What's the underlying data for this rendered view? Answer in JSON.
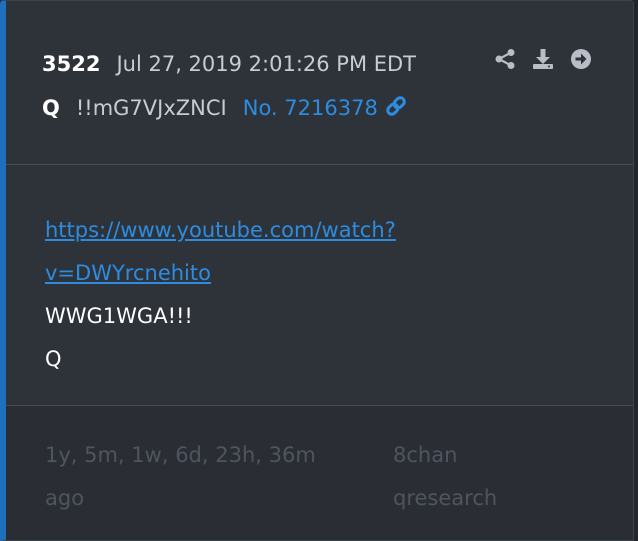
{
  "post": {
    "number": "3522",
    "date": "Jul 27, 2019 2:01:26 PM EDT",
    "author": "Q",
    "tripcode": "!!mG7VJxZNCI",
    "post_no": "No. 7216378",
    "link_line1": "https://www.youtube.com/watch?",
    "link_line2": "v=DWYrcnehito",
    "text_line1": "WWG1WGA!!!",
    "text_line2": "Q",
    "ago_line1": "1y, 5m, 1w, 6d, 23h, 36m",
    "ago_line2": "ago",
    "board_line1": "8chan",
    "board_line2": "qresearch"
  },
  "actions": {
    "share_icon": "share-icon",
    "download_icon": "download-icon",
    "goto_icon": "arrow-circle-right-icon"
  },
  "colors": {
    "accent": "#1f6fbf",
    "link": "#2d8ce0",
    "card_bg": "#2e333a",
    "footer_text": "#4f555e"
  }
}
